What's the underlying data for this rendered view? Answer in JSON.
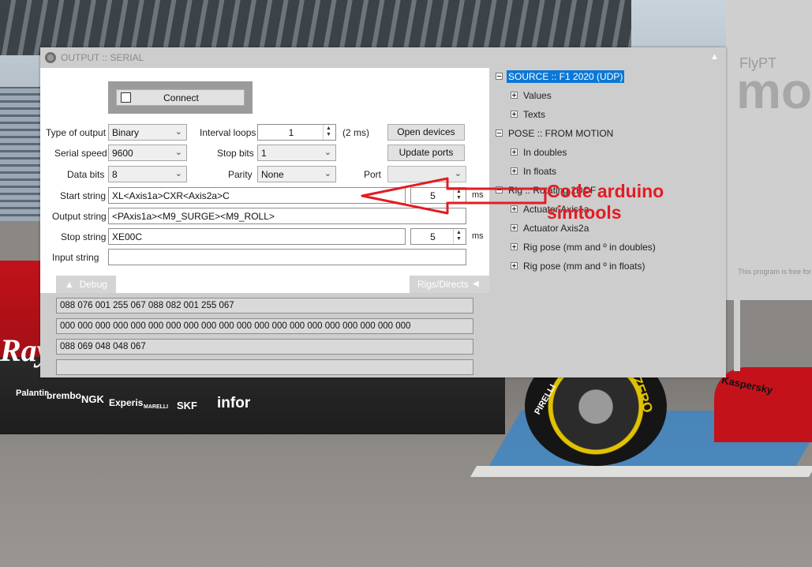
{
  "window": {
    "title": "OUTPUT :: SERIAL"
  },
  "connect": {
    "label": "Connect"
  },
  "form": {
    "type_of_output": {
      "label": "Type of output",
      "value": "Binary"
    },
    "serial_speed": {
      "label": "Serial speed",
      "value": "9600"
    },
    "data_bits": {
      "label": "Data bits",
      "value": "8"
    },
    "interval_loops": {
      "label": "Interval loops",
      "value": "1",
      "unit": "(2 ms)"
    },
    "stop_bits": {
      "label": "Stop bits",
      "value": "1"
    },
    "parity": {
      "label": "Parity",
      "value": "None"
    },
    "port": {
      "label": "Port",
      "value": ""
    },
    "open_devices": "Open devices",
    "update_ports": "Update ports",
    "start_string": {
      "label": "Start string",
      "value": "XL<Axis1a>CXR<Axis2a>C",
      "delay": "5",
      "unit": "ms"
    },
    "output_string": {
      "label": "Output string",
      "value": "<PAxis1a><M9_SURGE><M9_ROLL>"
    },
    "stop_string": {
      "label": "Stop string",
      "value": "XE00C",
      "delay": "5",
      "unit": "ms"
    },
    "input_string": {
      "label": "Input string",
      "value": ""
    }
  },
  "tabs": {
    "debug": "Debug",
    "rigs": "Rigs/Directs"
  },
  "debug_lines": [
    "088 076 001 255 067 088 082 001 255 067",
    "000 000 000 000 000 000 000 000 000 000 000 000 000 000 000 000 000 000 000 000",
    "088 069 048 048 067",
    ""
  ],
  "tree": [
    {
      "label": "SOURCE :: F1 2020 (UDP)",
      "level": 0,
      "expanded": true,
      "selected": true
    },
    {
      "label": "Values",
      "level": 1,
      "expanded": false
    },
    {
      "label": "Texts",
      "level": 1,
      "expanded": false
    },
    {
      "label": "POSE :: FROM MOTION",
      "level": 0,
      "expanded": true
    },
    {
      "label": "In doubles",
      "level": 1,
      "expanded": false
    },
    {
      "label": "In floats",
      "level": 1,
      "expanded": false
    },
    {
      "label": "Rig :: Rotating 2DOF",
      "level": 0,
      "expanded": true
    },
    {
      "label": "Actuator Axis1a",
      "level": 1,
      "expanded": false
    },
    {
      "label": "Actuator Axis2a",
      "level": 1,
      "expanded": false
    },
    {
      "label": "Rig pose (mm and º in doubles)",
      "level": 1,
      "expanded": false
    },
    {
      "label": "Rig pose (mm and º in floats)",
      "level": 1,
      "expanded": false
    }
  ],
  "annotation": {
    "line1": "Code arduino",
    "line2": "simtools",
    "color": "#e31b23"
  },
  "background": {
    "flypt_title": "FlyPT",
    "flypt_big": "mo",
    "flypt_note": "This program is free for",
    "sponsors": [
      "Ray",
      "Palantir",
      "brembo",
      "NGK",
      "Experis",
      "MARELLI",
      "SKF",
      "infor",
      "ZERO",
      "PIRELLI",
      "Kaspersky"
    ]
  }
}
